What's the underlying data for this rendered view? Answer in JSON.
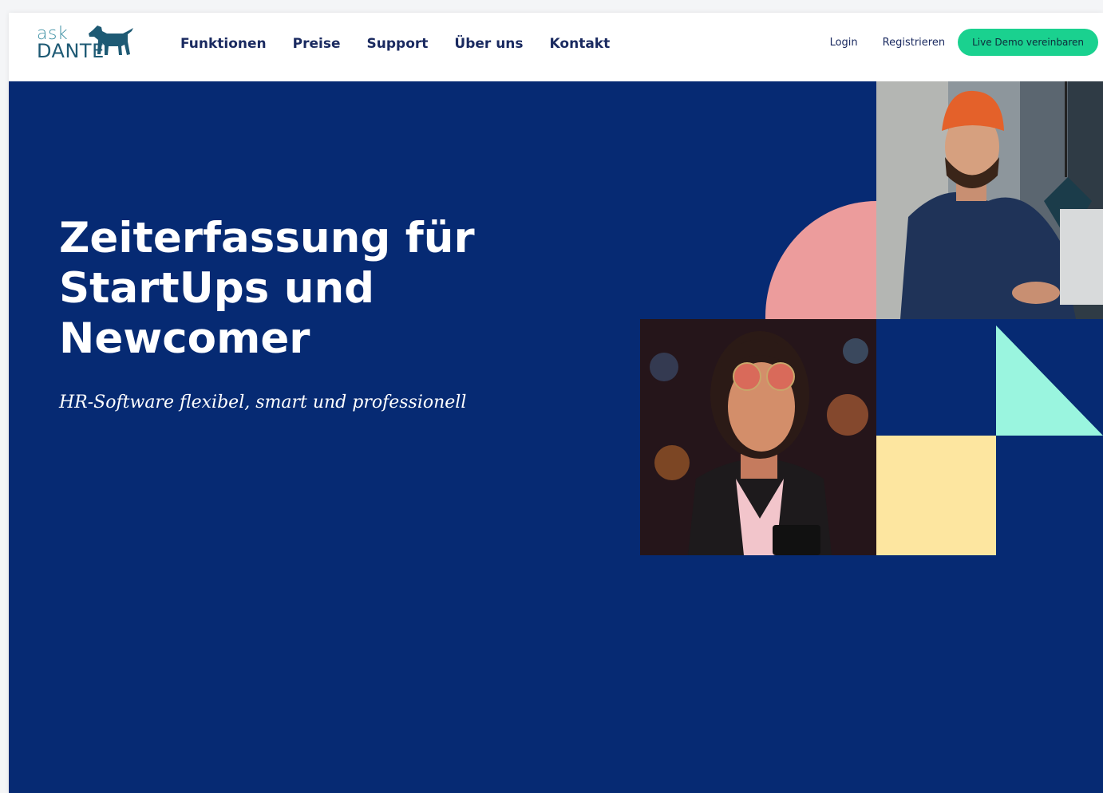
{
  "header": {
    "logo_top": "ask",
    "logo_bottom": "DANTE",
    "nav": [
      "Funktionen",
      "Preise",
      "Support",
      "Über uns",
      "Kontakt"
    ],
    "login": "Login",
    "register": "Registrieren",
    "cta": "Live Demo vereinbaren"
  },
  "hero": {
    "headline_line1": "Zeiterfassung für",
    "headline_line2": "StartUps und",
    "headline_line3": "Newcomer",
    "subline": "HR-Software flexibel, smart und professionell"
  },
  "colors": {
    "navy": "#062a73",
    "cta_green": "#1ad18f",
    "pink": "#ec9c9c",
    "mint": "#9af5df",
    "yellow": "#fde6a0"
  }
}
